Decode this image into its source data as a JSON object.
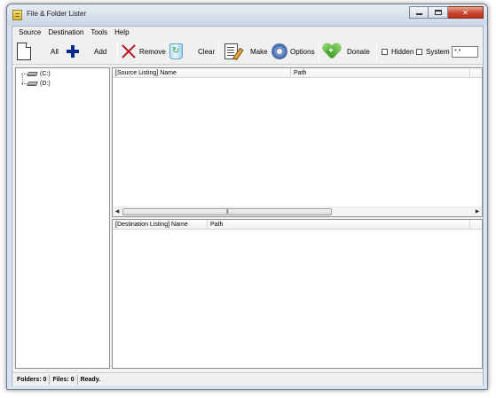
{
  "window": {
    "title": "File & Folder Lister"
  },
  "menu": [
    "Source",
    "Destination",
    "Tools",
    "Help"
  ],
  "toolbar": {
    "all_label": "All",
    "add_label": "Add",
    "remove_label": "Remove",
    "clear_label": "Clear",
    "make_label": "Make",
    "options_label": "Options",
    "donate_label": "Donate",
    "hidden_label": "Hidden",
    "system_label": "System",
    "filter_value": "*.*"
  },
  "tree": {
    "drives": [
      "(C:)",
      "(D:)"
    ]
  },
  "source_listing": {
    "columns": [
      "[Source Listing] Name",
      "Path"
    ],
    "scroll_grip": "|||"
  },
  "destination_listing": {
    "columns": [
      "[Destination Listing] Name",
      "Path"
    ]
  },
  "status": {
    "folders": "Folders: 0",
    "files": "Files: 0",
    "message": "Ready."
  },
  "icons": [
    "new-document-icon",
    "plus-icon",
    "remove-x-icon",
    "recycle-bin-icon",
    "edit-note-icon",
    "gear-icon",
    "heart-plus-icon"
  ]
}
